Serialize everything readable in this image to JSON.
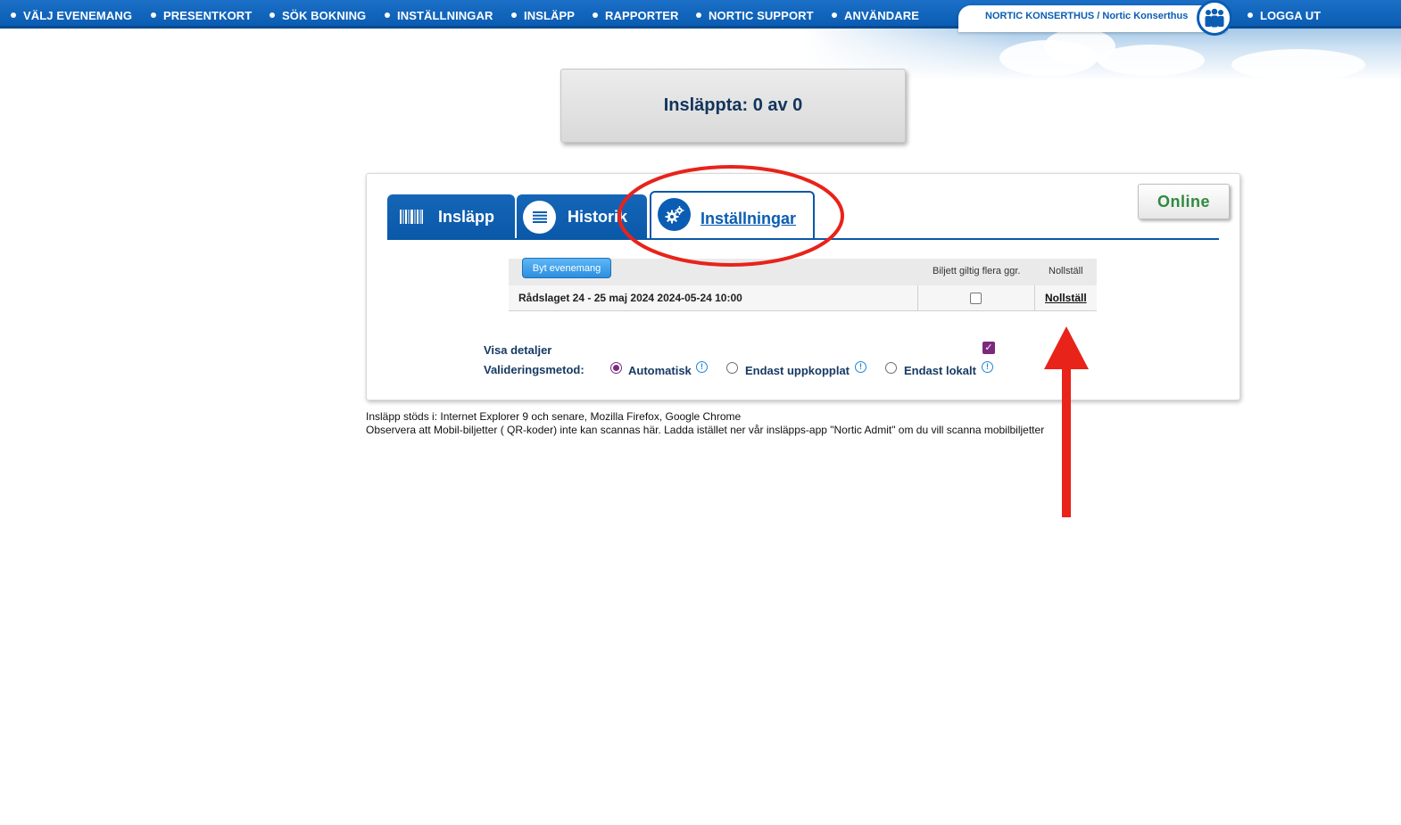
{
  "nav": {
    "items": [
      "VÄLJ EVENEMANG",
      "PRESENTKORT",
      "SÖK BOKNING",
      "INSTÄLLNINGAR",
      "INSLÄPP",
      "RAPPORTER",
      "NORTIC SUPPORT",
      "ANVÄNDARE"
    ],
    "org_label": "NORTIC KONSERTHUS / Nortic Konserthus",
    "logout": "LOGGA UT"
  },
  "counter": {
    "text": "Insläppta: 0 av 0"
  },
  "tabs": [
    {
      "label": "Insläpp",
      "icon": "barcode-icon",
      "active": false
    },
    {
      "label": "Historik",
      "icon": "list-icon",
      "active": false
    },
    {
      "label": "Inställningar",
      "icon": "gears-icon",
      "active": true
    }
  ],
  "status": {
    "label": "Online"
  },
  "event_table": {
    "change_button": "Byt evenemang",
    "headers": [
      "Biljett giltig flera ggr.",
      "Nollställ"
    ],
    "rows": [
      {
        "event": "Rådslaget 24 - 25 maj 2024 2024-05-24 10:00",
        "multi_valid": false,
        "reset": "Nollställ"
      }
    ]
  },
  "options": {
    "show_details_label": "Visa detaljer",
    "show_details": true,
    "validation_label": "Valideringsmetod:",
    "validation_methods": [
      {
        "label": "Automatisk",
        "selected": true
      },
      {
        "label": "Endast uppkopplat",
        "selected": false
      },
      {
        "label": "Endast lokalt",
        "selected": false
      }
    ],
    "info_symbol": "!"
  },
  "footer": {
    "line1": "Insläpp stöds i: Internet Explorer 9 och senare, Mozilla Firefox, Google Chrome",
    "line2": "Observera att Mobil-biljetter ( QR-koder) inte kan scannas här. Ladda istället ner vår insläpps-app \"Nortic Admit\" om du vill scanna mobilbiljetter"
  },
  "colors": {
    "nav_blue": "#0a5db3",
    "online_green": "#2e8a3d",
    "radio_purple": "#7b2a7e",
    "annotation_red": "#e8231a"
  }
}
